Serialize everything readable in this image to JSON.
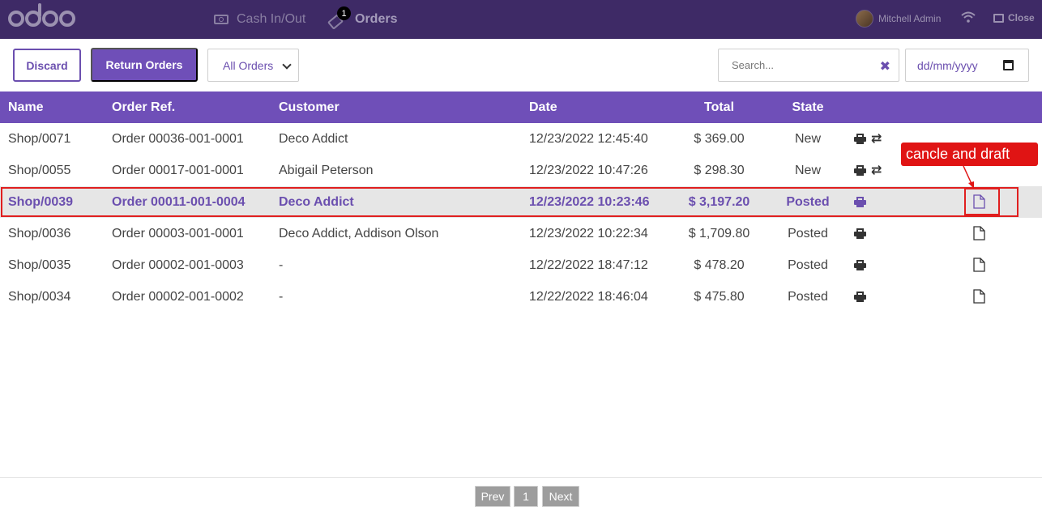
{
  "topbar": {
    "nav": {
      "cash_label": "Cash In/Out",
      "orders_label": "Orders",
      "orders_badge": "1"
    },
    "user_name": "Mitchell Admin",
    "close_label": "Close",
    "icons": [
      "odoo-logo",
      "cash-icon",
      "tag-icon",
      "avatar",
      "wifi-icon",
      "logout-icon"
    ]
  },
  "controls": {
    "discard_label": "Discard",
    "return_label": "Return Orders",
    "filter_value": "All Orders",
    "search_placeholder": "Search...",
    "date_placeholder": "dd/mm/yyyy"
  },
  "table": {
    "columns": {
      "name": "Name",
      "ref": "Order Ref.",
      "customer": "Customer",
      "date": "Date",
      "total": "Total",
      "state": "State"
    },
    "rows": [
      {
        "name": "Shop/0071",
        "ref": "Order 00036-001-0001",
        "customer": "Deco Addict",
        "date": "12/23/2022 12:45:40",
        "total": "$ 369.00",
        "state": "New"
      },
      {
        "name": "Shop/0055",
        "ref": "Order 00017-001-0001",
        "customer": "Abigail Peterson",
        "date": "12/23/2022 10:47:26",
        "total": "$ 298.30",
        "state": "New"
      },
      {
        "name": "Shop/0039",
        "ref": "Order 00011-001-0004",
        "customer": "Deco Addict",
        "date": "12/23/2022 10:23:46",
        "total": "$ 3,197.20",
        "state": "Posted"
      },
      {
        "name": "Shop/0036",
        "ref": "Order 00003-001-0001",
        "customer": "Deco Addict, Addison Olson",
        "date": "12/23/2022 10:22:34",
        "total": "$ 1,709.80",
        "state": "Posted"
      },
      {
        "name": "Shop/0035",
        "ref": "Order 00002-001-0003",
        "customer": "-",
        "date": "12/22/2022 18:47:12",
        "total": "$ 478.20",
        "state": "Posted"
      },
      {
        "name": "Shop/0034",
        "ref": "Order 00002-001-0002",
        "customer": "-",
        "date": "12/22/2022 18:46:04",
        "total": "$ 475.80",
        "state": "Posted"
      }
    ]
  },
  "annotation": {
    "callout": "cancle and draft",
    "color": "#e01414"
  },
  "pager": {
    "prev": "Prev",
    "page": "1",
    "next": "Next"
  },
  "colors": {
    "topbar": "#3e2a66",
    "accent": "#6f4fb8",
    "selected_row": "#e6e6e6"
  }
}
